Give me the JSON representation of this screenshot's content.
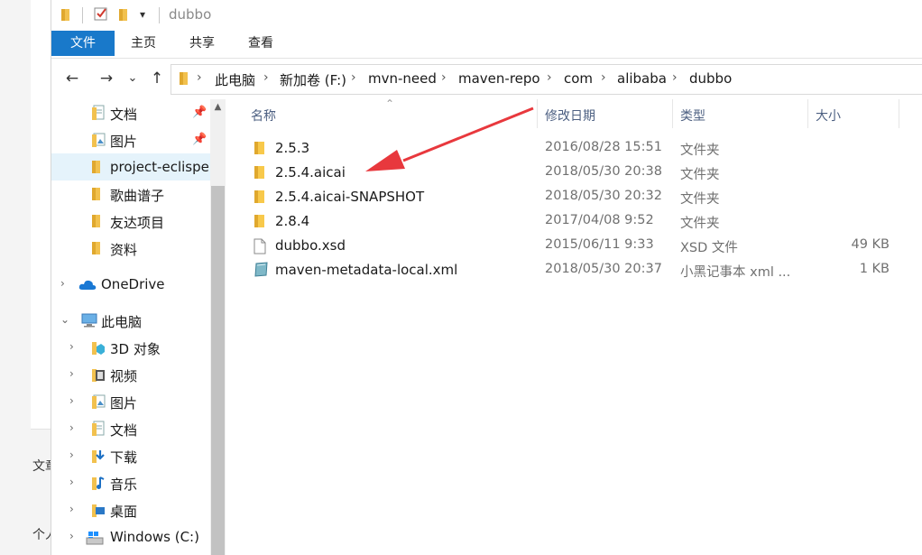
{
  "window": {
    "title": "dubbo",
    "quick_access_dropdown": "▾"
  },
  "background": {
    "side_text_1": "文章",
    "side_text_2": "个人"
  },
  "ribbon": {
    "tabs": [
      {
        "label": "文件"
      },
      {
        "label": "主页"
      },
      {
        "label": "共享"
      },
      {
        "label": "查看"
      }
    ]
  },
  "nav": {
    "back": "←",
    "forward": "→",
    "recent": "⌄",
    "up": "↑",
    "breadcrumb": [
      "此电脑",
      "新加卷 (F:)",
      "mvn-need",
      "maven-repo",
      "com",
      "alibaba",
      "dubbo"
    ]
  },
  "navpane": {
    "items": [
      {
        "label": "文档",
        "icon": "documents-icon",
        "pinned": true
      },
      {
        "label": "图片",
        "icon": "pictures-icon",
        "pinned": true
      },
      {
        "label": "project-eclispe",
        "icon": "folder-icon",
        "selected": true
      },
      {
        "label": "歌曲谱子",
        "icon": "folder-icon"
      },
      {
        "label": "友达项目",
        "icon": "folder-icon"
      },
      {
        "label": "资料",
        "icon": "folder-icon"
      },
      {
        "label": "OneDrive",
        "icon": "onedrive-icon"
      },
      {
        "label": "此电脑",
        "icon": "this-pc-icon"
      },
      {
        "label": "3D 对象",
        "icon": "3d-objects-icon"
      },
      {
        "label": "视频",
        "icon": "videos-icon"
      },
      {
        "label": "图片",
        "icon": "pictures-icon"
      },
      {
        "label": "文档",
        "icon": "documents-icon"
      },
      {
        "label": "下载",
        "icon": "downloads-icon"
      },
      {
        "label": "音乐",
        "icon": "music-icon"
      },
      {
        "label": "桌面",
        "icon": "desktop-icon"
      },
      {
        "label": "Windows (C:)",
        "icon": "windows-drive-icon"
      }
    ]
  },
  "filelist": {
    "columns": {
      "name": "名称",
      "modified": "修改日期",
      "type": "类型",
      "size": "大小"
    },
    "rows": [
      {
        "name": "2.5.3",
        "modified": "2016/08/28 15:51",
        "type": "文件夹",
        "size": "",
        "icon": "folder-icon"
      },
      {
        "name": "2.5.4.aicai",
        "modified": "2018/05/30 20:38",
        "type": "文件夹",
        "size": "",
        "icon": "folder-icon"
      },
      {
        "name": "2.5.4.aicai-SNAPSHOT",
        "modified": "2018/05/30 20:32",
        "type": "文件夹",
        "size": "",
        "icon": "folder-icon"
      },
      {
        "name": "2.8.4",
        "modified": "2017/04/08 9:52",
        "type": "文件夹",
        "size": "",
        "icon": "folder-icon"
      },
      {
        "name": "dubbo.xsd",
        "modified": "2015/06/11 9:33",
        "type": "XSD 文件",
        "size": "49 KB",
        "icon": "file-icon"
      },
      {
        "name": "maven-metadata-local.xml",
        "modified": "2018/05/30 20:37",
        "type": "小黑记事本 xml ...",
        "size": "1 KB",
        "icon": "notepad-xml-icon"
      }
    ]
  },
  "annotation": {
    "color": "#e8383d"
  },
  "colors": {
    "accent": "#1979ca",
    "folder": "#f8c94b",
    "selected": "#e5f3fb"
  }
}
